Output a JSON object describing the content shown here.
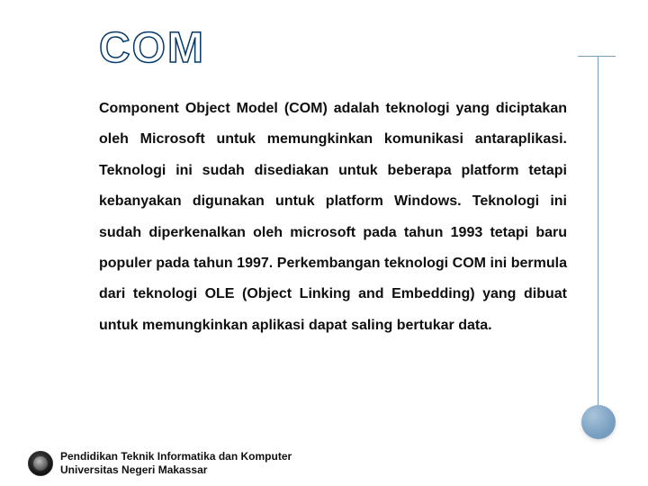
{
  "title": "COM",
  "body": "Component Object Model (COM) adalah teknologi yang diciptakan oleh Microsoft untuk memungkinkan komunikasi antaraplikasi. Teknologi ini sudah disediakan untuk beberapa platform tetapi kebanyakan digunakan untuk platform Windows. Teknologi ini sudah diperkenalkan oleh microsoft pada tahun 1993 tetapi baru populer pada tahun 1997. Perkembangan teknologi COM ini bermula dari teknologi OLE (Object Linking and Embedding) yang dibuat untuk memungkinkan aplikasi dapat saling bertukar data.",
  "footer": {
    "line1": "Pendidikan Teknik Informatika dan Komputer",
    "line2": "Universitas Negeri Makassar"
  }
}
